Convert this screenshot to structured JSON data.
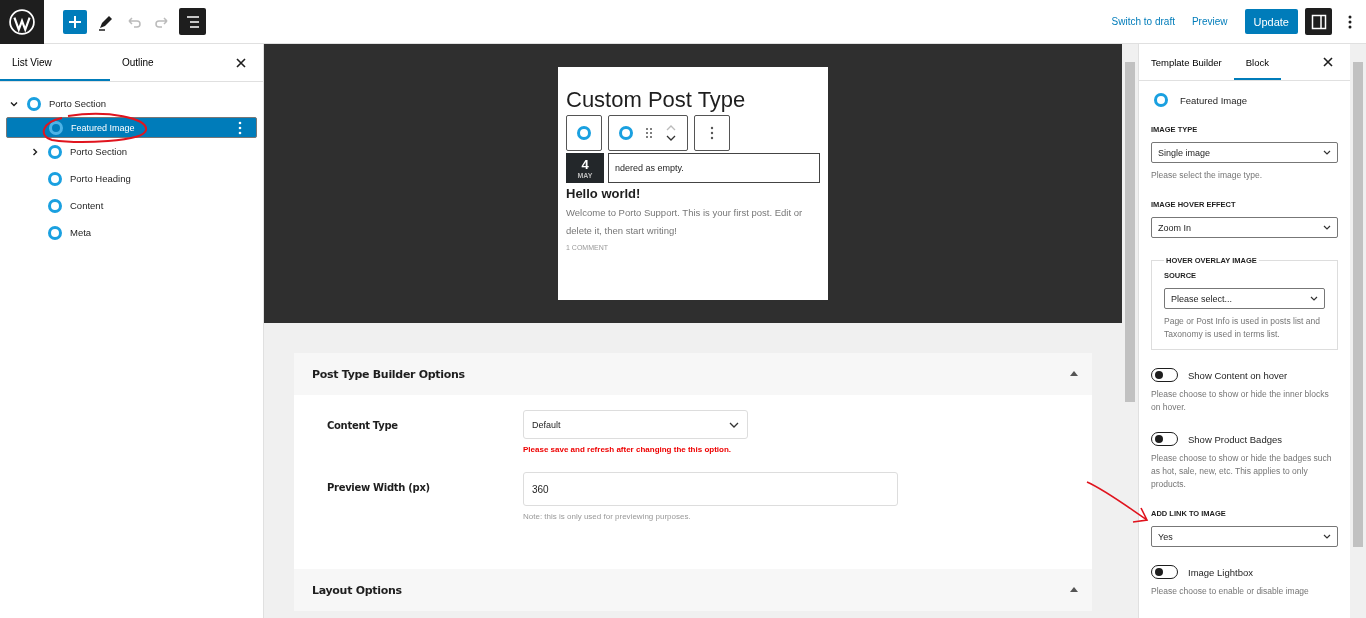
{
  "toolbar": {
    "actions": [
      "Switch to draft",
      "Preview"
    ],
    "primary": "Update"
  },
  "left_panel": {
    "tabs": [
      {
        "label": "List View",
        "selected": true
      },
      {
        "label": "Outline",
        "selected": false
      }
    ],
    "tree": [
      {
        "label": "Porto Section",
        "selected": false,
        "expanded": true,
        "children": [
          {
            "label": "Featured Image",
            "selected": true
          },
          {
            "label": "Porto Section",
            "selected": false,
            "expanded": false
          },
          {
            "label": "Porto Heading",
            "selected": false
          },
          {
            "label": "Content",
            "selected": false
          },
          {
            "label": "Meta",
            "selected": false
          }
        ]
      }
    ]
  },
  "preview": {
    "heading": "Custom Post Type",
    "date": {
      "day": "4",
      "month": "MAY"
    },
    "notice": "ndered as empty.",
    "post_title": "Hello world!",
    "excerpt": "Welcome to Porto Support. This is your first post. Edit or delete it, then start writing!",
    "comments": "1 COMMENT"
  },
  "options": [
    {
      "title": "Post Type Builder Options",
      "expanded": true,
      "fields": [
        {
          "kind": "select",
          "label": "Content Type",
          "value": "Default",
          "warning": "Please save and refresh after changing the this option."
        },
        {
          "kind": "input",
          "label": "Preview Width (px)",
          "value": "360",
          "note": "Note: this is only used for previewing purposes."
        }
      ]
    },
    {
      "title": "Layout Options",
      "expanded": true
    }
  ],
  "sidebar": {
    "tabs": [
      {
        "label": "Template Builder",
        "selected": false
      },
      {
        "label": "Block",
        "selected": true
      }
    ],
    "block_name": "Featured Image",
    "controls": [
      {
        "kind": "select",
        "label": "IMAGE TYPE",
        "value": "Single image",
        "help": "Please select the image type."
      },
      {
        "kind": "select",
        "label": "IMAGE HOVER EFFECT",
        "value": "Zoom In"
      },
      {
        "kind": "group",
        "legend": "HOVER OVERLAY IMAGE",
        "label": "SOURCE",
        "value": "Please select...",
        "help": "Page or Post Info is used in posts list and Taxonomy is used in terms list."
      },
      {
        "kind": "toggle",
        "label": "Show Content on hover",
        "on": false,
        "help": "Please choose to show or hide the inner blocks on hover."
      },
      {
        "kind": "toggle",
        "label": "Show Product Badges",
        "on": false,
        "help": "Please choose to show or hide the badges such as hot, sale, new, etc. This applies to only products."
      },
      {
        "kind": "select",
        "label": "ADD LINK TO IMAGE",
        "value": "Yes"
      },
      {
        "kind": "toggle",
        "label": "Image Lightbox",
        "on": false,
        "help": "Please choose to enable or disable image"
      }
    ]
  }
}
